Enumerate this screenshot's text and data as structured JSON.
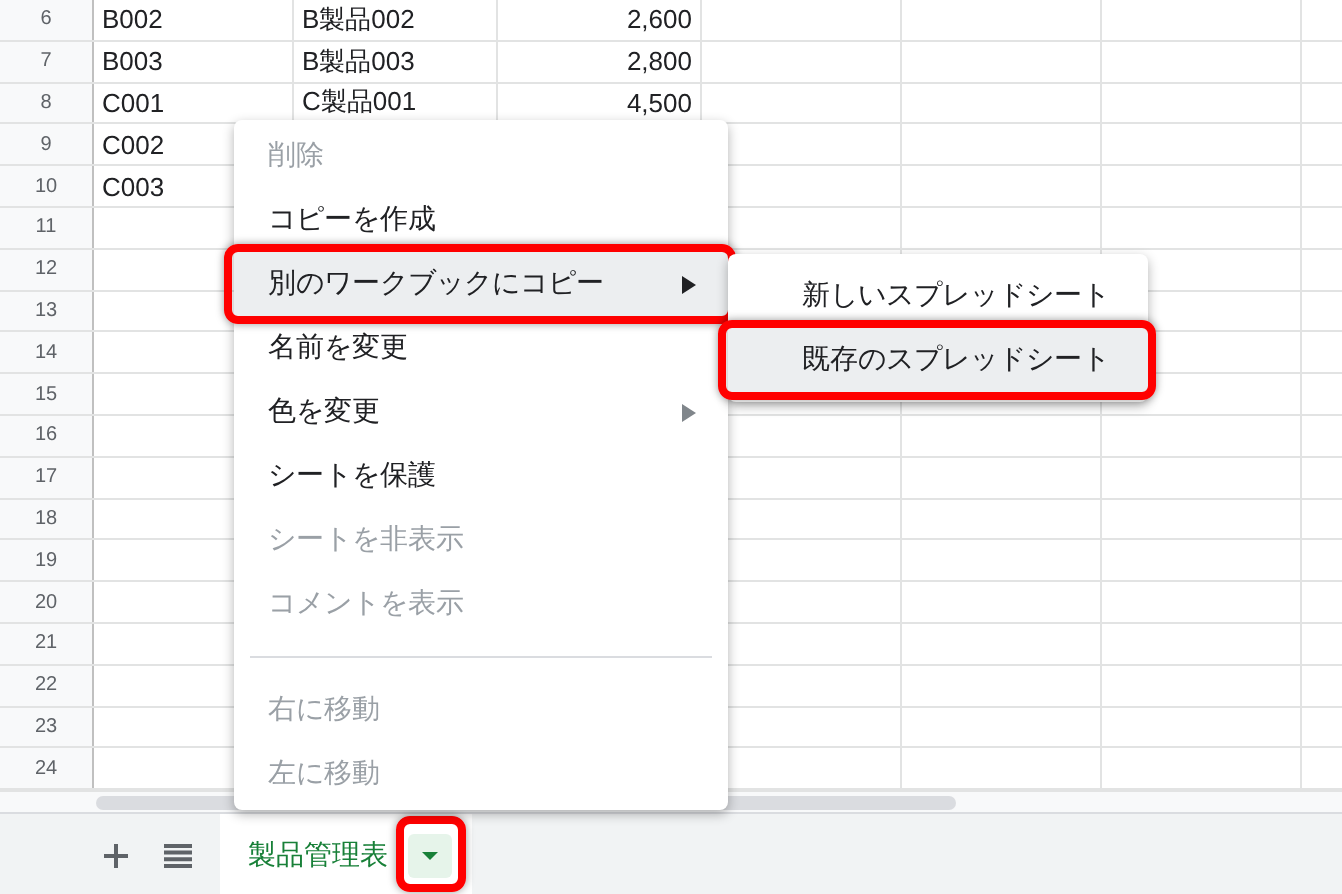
{
  "grid": {
    "rows": [
      {
        "number": "6",
        "cells": [
          "B002",
          "B製品002",
          "2,600"
        ]
      },
      {
        "number": "7",
        "cells": [
          "B003",
          "B製品003",
          "2,800"
        ]
      },
      {
        "number": "8",
        "cells": [
          "C001",
          "C製品001",
          "4,500"
        ]
      },
      {
        "number": "9",
        "cells": [
          "C002"
        ]
      },
      {
        "number": "10",
        "cells": [
          "C003"
        ]
      },
      {
        "number": "11",
        "cells": []
      },
      {
        "number": "12",
        "cells": []
      },
      {
        "number": "13",
        "cells": []
      },
      {
        "number": "14",
        "cells": []
      },
      {
        "number": "15",
        "cells": []
      },
      {
        "number": "16",
        "cells": []
      },
      {
        "number": "17",
        "cells": []
      },
      {
        "number": "18",
        "cells": []
      },
      {
        "number": "19",
        "cells": []
      },
      {
        "number": "20",
        "cells": []
      },
      {
        "number": "21",
        "cells": []
      },
      {
        "number": "22",
        "cells": []
      },
      {
        "number": "23",
        "cells": []
      },
      {
        "number": "24",
        "cells": []
      }
    ]
  },
  "context_menu": {
    "items": [
      {
        "kind": "item",
        "label": "削除",
        "disabled": true,
        "submenu": false,
        "highlighted": false,
        "marked": false
      },
      {
        "kind": "item",
        "label": "コピーを作成",
        "disabled": false,
        "submenu": false,
        "highlighted": false,
        "marked": false
      },
      {
        "kind": "item",
        "label": "別のワークブックにコピー",
        "disabled": false,
        "submenu": true,
        "highlighted": true,
        "marked": true
      },
      {
        "kind": "item",
        "label": "名前を変更",
        "disabled": false,
        "submenu": false,
        "highlighted": false,
        "marked": false
      },
      {
        "kind": "item",
        "label": "色を変更",
        "disabled": false,
        "submenu": true,
        "highlighted": false,
        "marked": false
      },
      {
        "kind": "item",
        "label": "シートを保護",
        "disabled": false,
        "submenu": false,
        "highlighted": false,
        "marked": false
      },
      {
        "kind": "item",
        "label": "シートを非表示",
        "disabled": true,
        "submenu": false,
        "highlighted": false,
        "marked": false
      },
      {
        "kind": "item",
        "label": "コメントを表示",
        "disabled": true,
        "submenu": false,
        "highlighted": false,
        "marked": false
      },
      {
        "kind": "divider"
      },
      {
        "kind": "item",
        "label": "右に移動",
        "disabled": true,
        "submenu": false,
        "highlighted": false,
        "marked": false
      },
      {
        "kind": "item",
        "label": "左に移動",
        "disabled": true,
        "submenu": false,
        "highlighted": false,
        "marked": false
      }
    ]
  },
  "submenu": {
    "items": [
      {
        "label": "新しいスプレッドシート",
        "highlighted": false,
        "marked": false
      },
      {
        "label": "既存のスプレッドシート",
        "highlighted": true,
        "marked": true
      }
    ]
  },
  "sheet_bar": {
    "tabs": [
      {
        "label": "製品管理表",
        "selected": true,
        "menu_marked": true
      }
    ]
  }
}
